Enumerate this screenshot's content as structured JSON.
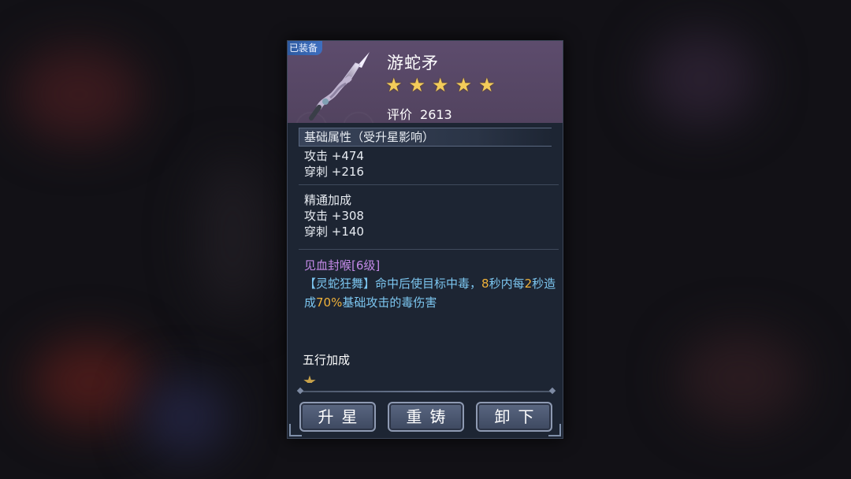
{
  "panel": {
    "equipped_tag": "已装备",
    "item_name": "游蛇矛",
    "stars": 5,
    "rating_label": "评价",
    "rating_value": "2613",
    "base_section_title": "基础属性（受升星影响）",
    "base_stats": [
      "攻击 +474",
      "穿刺 +216"
    ],
    "mastery_title": "精通加成",
    "mastery_stats": [
      "攻击 +308",
      "穿刺 +140"
    ],
    "skill_name": "见血封喉[6级]",
    "skill_desc_prefix": "【灵蛇狂舞】命中后使目标中毒，",
    "skill_desc_hl1": "8",
    "skill_desc_mid1": "秒内每",
    "skill_desc_hl2": "2",
    "skill_desc_mid2": "秒造成",
    "skill_desc_hl3": "70%",
    "skill_desc_suffix": "基础攻击的毒伤害",
    "wuxing_title": "五行加成",
    "buttons": {
      "upgrade": "升星",
      "recast": "重铸",
      "unequip": "卸下"
    }
  },
  "colors": {
    "accent": "#f0b23a",
    "skill_name": "#c48ae8",
    "skill_desc": "#7cc6f0",
    "header": "#5d4c6d"
  }
}
